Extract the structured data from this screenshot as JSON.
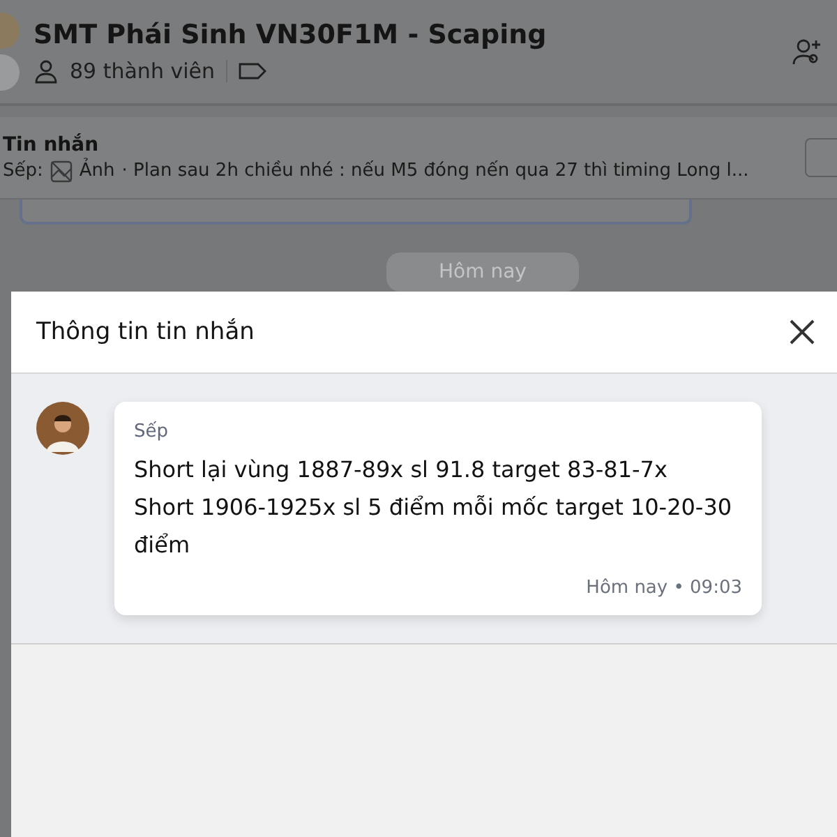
{
  "header": {
    "title": "SMT Phái Sinh VN30F1M - Scaping",
    "members": "89 thành viên"
  },
  "pinned": {
    "title": "Tin nhắn",
    "sender": "Sếp:",
    "attachment": "Ảnh",
    "preview": "· Plan sau 2h chiều nhé : nếu M5 đóng nến qua 27 thì timing Long l..."
  },
  "date_divider": "Hôm nay",
  "dialog": {
    "title": "Thông tin tin nhắn",
    "message": {
      "sender": "Sếp",
      "lines": [
        "Short lại vùng 1887-89x sl 91.8 target 83-81-7x",
        "Short 1906-1925x sl 5 điểm mỗi mốc target 10-20-30 điểm"
      ],
      "time": "Hôm nay • 09:03"
    }
  }
}
